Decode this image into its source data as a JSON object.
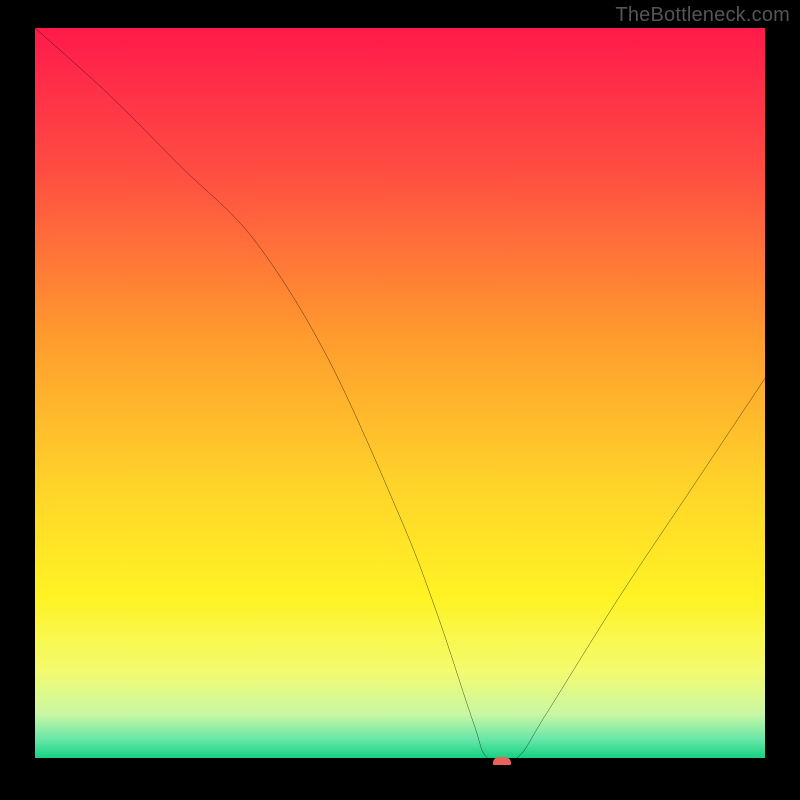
{
  "watermark": "TheBottleneck.com",
  "chart_data": {
    "type": "line",
    "title": "",
    "xlabel": "",
    "ylabel": "",
    "xlim": [
      0,
      100
    ],
    "ylim": [
      0,
      100
    ],
    "series": [
      {
        "name": "bottleneck-curve",
        "x": [
          0,
          10,
          20,
          30,
          40,
          50,
          55,
          60,
          62,
          66,
          70,
          80,
          90,
          100
        ],
        "y": [
          100,
          91,
          81,
          71,
          55,
          33,
          20,
          5,
          0,
          0,
          6,
          22,
          37,
          52
        ]
      }
    ],
    "marker": {
      "x": 64,
      "y": 0,
      "color": "#e8615b"
    },
    "gradient_stops": [
      {
        "pos": 0.0,
        "color": "#ff1a4b"
      },
      {
        "pos": 0.2,
        "color": "#ff4e42"
      },
      {
        "pos": 0.42,
        "color": "#ff9a2e"
      },
      {
        "pos": 0.62,
        "color": "#ffd22a"
      },
      {
        "pos": 0.78,
        "color": "#fff324"
      },
      {
        "pos": 0.88,
        "color": "#f4fb6e"
      },
      {
        "pos": 0.94,
        "color": "#c9f7a4"
      },
      {
        "pos": 0.975,
        "color": "#66e6a8"
      },
      {
        "pos": 1.0,
        "color": "#17d183"
      }
    ]
  }
}
